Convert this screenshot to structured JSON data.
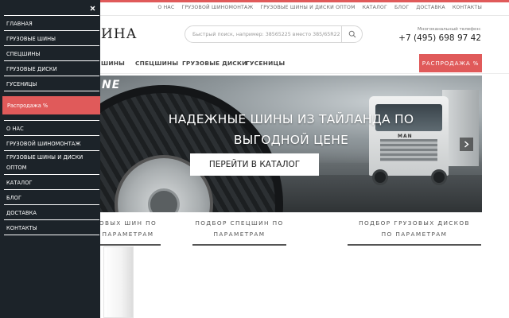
{
  "topnav": {
    "items": [
      "О НАС",
      "ГРУЗОВОЙ ШИНОМОНТАЖ",
      "ГРУЗОВЫЕ ШИНЫ И ДИСКИ ОПТОМ",
      "КАТАЛОГ",
      "БЛОГ",
      "ДОСТАВКА",
      "КОНТАКТЫ"
    ]
  },
  "header": {
    "logo_fragment": "ИНА",
    "search_placeholder": "Быстрый поиск, например: 38565225 вместо 385/65R22",
    "phone_caption": "Многоканальный телефон:",
    "phone": "+7 (495) 698 97 42"
  },
  "catnav": {
    "items": [
      "ШИНЫ",
      "СПЕЦШИНЫ",
      "ГРУЗОВЫЕ ДИСКИ",
      "ГУСЕНИЦЫ"
    ],
    "sale": "РАСПРОДАЖА %"
  },
  "hero": {
    "logo_fragment": "NE",
    "title_line1": "НАДЕЖНЫЕ ШИНЫ ИЗ ТАЙЛАНДА ПО",
    "title_line2": "ВЫГОДНОЙ ЦЕНЕ",
    "cta": "ПЕРЕЙТИ В КАТАЛОГ",
    "truck_badge": "MAN",
    "next_icon": "chevron-right-icon"
  },
  "pickers": [
    {
      "line1": "ОВЫХ ШИН ПО",
      "line2": "ПАРАМЕТРАМ"
    },
    {
      "line1": "ПОДБОР СПЕЦШИН ПО",
      "line2": "ПАРАМЕТРАМ"
    },
    {
      "line1": "ПОДБОР ГРУЗОВЫХ ДИСКОВ",
      "line2": "ПО ПАРАМЕТРАМ"
    }
  ],
  "drawer": {
    "close_icon": "close-icon",
    "catalog": [
      "ГЛАВНАЯ",
      "ГРУЗОВЫЕ ШИНЫ",
      "СПЕЦШИНЫ",
      "ГРУЗОВЫЕ ДИСКИ",
      "ГУСЕНИЦЫ"
    ],
    "sale": "Распродажа %",
    "info": [
      "О НАС",
      "ГРУЗОВОЙ ШИНОМОНТАЖ",
      "ГРУЗОВЫЕ ШИНЫ И ДИСКИ ОПТОМ",
      "КАТАЛОГ",
      "БЛОГ",
      "ДОСТАВКА",
      "КОНТАКТЫ"
    ]
  },
  "colors": {
    "accent": "#e05a5a",
    "drawer_bg": "#1c2329"
  }
}
